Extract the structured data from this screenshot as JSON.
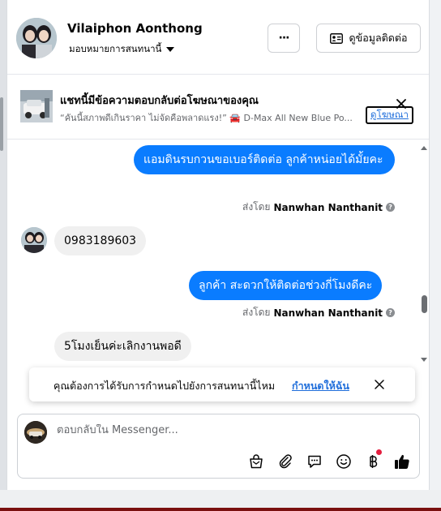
{
  "header": {
    "contact_name": "Vilaiphon Aonthong",
    "assign_label": "มอบหมายการสนทนานี้",
    "more_label": "···",
    "contact_info_label": "ดูข้อมูลติดต่อ"
  },
  "ad_banner": {
    "title": "แชทนี้มีข้อความตอบกลับต่อโฆษณาของคุณ",
    "subtitle": "“คันนี้สภาพดีเกินราคา ไม่จัดคือพลาดแรง!” 🚘 D-Max All New Blue Po...",
    "view_ad_label": "ดูโฆษณา"
  },
  "messages": [
    {
      "direction": "outgoing",
      "text": "แอมดินรบกวนขอเบอร์ติดต่อ ลูกค้าหน่อยได้มั้ยคะ",
      "sent_by_prefix": "ส่งโดย",
      "sent_by_name": "Nanwhan Nanthanit"
    },
    {
      "direction": "incoming",
      "text": "0983189603"
    },
    {
      "direction": "outgoing",
      "text": "ลูกค้า สะดวกให้ติดต่อช่วงกี่โมงดีคะ",
      "sent_by_prefix": "ส่งโดย",
      "sent_by_name": "Nanwhan Nanthanit"
    },
    {
      "direction": "incoming",
      "text": "5โมงเย็นค่ะเลิกงานพอดี"
    }
  ],
  "toast": {
    "text": "คุณต้องการได้รับการกำหนดไปยังการสนทนานี้ไหม",
    "action_label": "กำหนดให้ฉัน"
  },
  "composer": {
    "placeholder": "ตอบกลับใน Messenger...",
    "tools": [
      "bag-icon",
      "paperclip-icon",
      "saved-reply-icon",
      "emoji-icon",
      "baht-icon",
      "thumbs-up-icon"
    ],
    "notification_dot_color": "#e41e3f"
  },
  "colors": {
    "accent": "#0a7cff",
    "link": "#216fdb",
    "incoming_bubble": "#f0f0f0"
  }
}
